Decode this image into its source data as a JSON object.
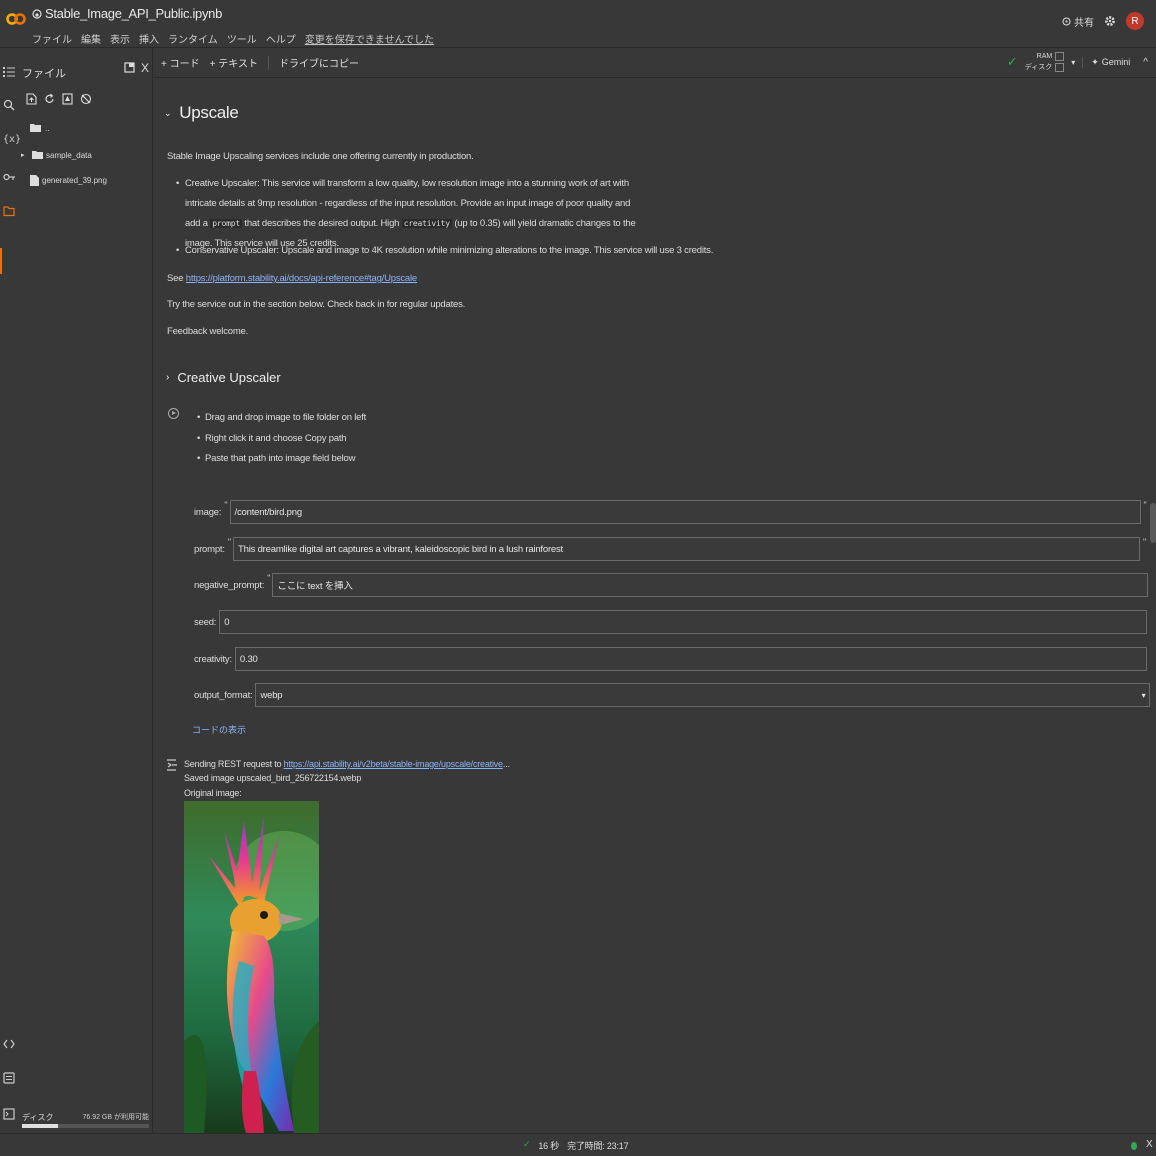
{
  "notebook": {
    "title": "Stable_Image_API_Public.ipynb",
    "menu": [
      "ファイル",
      "編集",
      "表示",
      "挿入",
      "ランタイム",
      "ツール",
      "ヘルプ"
    ],
    "unsaved": "変更を保存できませんでした",
    "share": "共有",
    "avatar_letter": "R"
  },
  "toolbar": {
    "add_code": "+ コード",
    "add_text": "+ テキスト",
    "copy_to_drive": "ドライブにコピー",
    "ram": "RAM",
    "disk": "ディスク",
    "gemini": "Gemini"
  },
  "files": {
    "title": "ファイル",
    "items": [
      {
        "name": ".."
      },
      {
        "name": "sample_data"
      },
      {
        "name": "generated_39.png"
      }
    ],
    "disk_label": "ディスク",
    "disk_free": "76.92 GB が利用可能",
    "disk_used_fraction": 0.28
  },
  "section": {
    "heading": "Upscale",
    "intro": "Stable Image Upscaling services include one offering currently in production.",
    "bullet1_a": "Creative Upscaler: This service will transform a low quality, low resolution image into a stunning work of art with intricate details at 9mp resolution - regardless of the input resolution. Provide an input image of poor quality and add a",
    "bullet1_code1": "prompt",
    "bullet1_b": "that describes the desired output. High",
    "bullet1_code2": "creativity",
    "bullet1_c": "(up to 0.35) will yield dramatic changes to the image. This service will use 25 credits.",
    "bullet2": "Conservative Upscaler: Upscale and image to 4K resolution while minimizing alterations to the image. This service will use 3 credits.",
    "see_prefix": "See",
    "see_link": "https://platform.stability.ai/docs/api-reference#tag/Upscale",
    "try_text": "Try the service out in the section below. Check back in for regular updates.",
    "feedback": "Feedback welcome."
  },
  "creative": {
    "heading": "Creative Upscaler",
    "steps": [
      "Drag and drop image to file folder on left",
      "Right click it and choose Copy path",
      "Paste that path into image field below"
    ]
  },
  "form": {
    "image_label": "image:",
    "image_value": "/content/bird.png",
    "prompt_label": "prompt:",
    "prompt_value": "This dreamlike digital art captures a vibrant, kaleidoscopic bird in a lush rainforest",
    "negative_label": "negative_prompt:",
    "negative_value": "ここに text を挿入",
    "seed_label": "seed:",
    "seed_value": "0",
    "creativity_label": "creativity:",
    "creativity_value": "0.30",
    "format_label": "output_format:",
    "format_value": "webp",
    "show_code": "コードの表示"
  },
  "output": {
    "sending_prefix": "Sending REST request to",
    "sending_link": "https://api.stability.ai/v2beta/stable-image/upscale/creative",
    "sending_suffix": "...",
    "saved": "Saved image upscaled_bird_256722154.webp",
    "original": "Original image:"
  },
  "status": {
    "check": "✓",
    "duration": "16 秒",
    "done": "完了時間: 23:17",
    "close": "X"
  },
  "colors": {
    "accent": "#e8710a",
    "link": "#8ab4f8",
    "avatar": "#c0392b",
    "status_ok": "#34a853"
  }
}
